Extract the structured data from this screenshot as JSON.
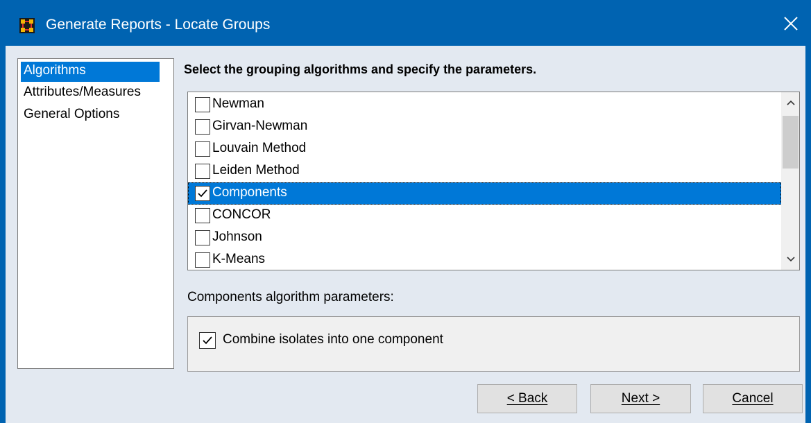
{
  "window": {
    "title": "Generate Reports - Locate Groups",
    "icon": "network-grid-icon",
    "close_glyph": "✕",
    "accent_color": "#0063b1"
  },
  "nav": {
    "items": [
      {
        "label": "Algorithms",
        "selected": true
      },
      {
        "label": "Attributes/Measures",
        "selected": false
      },
      {
        "label": "General Options",
        "selected": false
      }
    ]
  },
  "main": {
    "heading": "Select the grouping algorithms and specify the parameters.",
    "algorithms": [
      {
        "label": "Newman",
        "checked": false,
        "selected": false
      },
      {
        "label": "Girvan-Newman",
        "checked": false,
        "selected": false
      },
      {
        "label": "Louvain Method",
        "checked": false,
        "selected": false
      },
      {
        "label": "Leiden Method",
        "checked": false,
        "selected": false
      },
      {
        "label": "Components",
        "checked": true,
        "selected": true
      },
      {
        "label": "CONCOR",
        "checked": false,
        "selected": false
      },
      {
        "label": "Johnson",
        "checked": false,
        "selected": false
      },
      {
        "label": "K-Means",
        "checked": false,
        "selected": false
      }
    ],
    "params_label": "Components algorithm parameters:",
    "params": {
      "combine_isolates_label": "Combine isolates into one component",
      "combine_isolates_checked": true
    }
  },
  "buttons": {
    "back": "< Back",
    "next": "Next >",
    "cancel": "Cancel"
  }
}
